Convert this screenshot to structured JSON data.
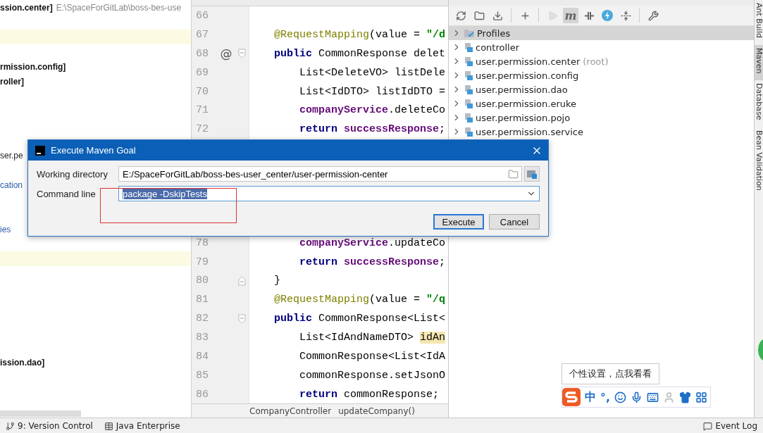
{
  "left_panel": {
    "rows": [
      {
        "kind": "header",
        "module": "ssion.center]",
        "path": "E:\\SpaceForGitLab\\boss-bes-use"
      },
      {
        "kind": "band"
      },
      {
        "kind": "module",
        "text": "rmission.config]"
      },
      {
        "kind": "module",
        "text": "roller]"
      },
      {
        "kind": "plain",
        "text": "ser.pe"
      },
      {
        "kind": "link",
        "text": "cation"
      },
      {
        "kind": "link",
        "text": "ies"
      },
      {
        "kind": "band"
      },
      {
        "kind": "module",
        "text": "ission.dao]"
      }
    ]
  },
  "editor": {
    "blocks": [
      {
        "lines": [
          {
            "number": "66",
            "fold": false
          },
          {
            "number": "67",
            "fold": false,
            "tokens": [
              {
                "kind": "ann",
                "text": "@RequestMapping"
              },
              {
                "kind": "plain",
                "text": "(value = "
              },
              {
                "kind": "str",
                "text": "\"/d"
              }
            ]
          },
          {
            "number": "68",
            "marker": "@",
            "fold": true,
            "tokens": [
              {
                "kind": "kw",
                "text": "public"
              },
              {
                "kind": "plain",
                "text": " CommonResponse delet"
              }
            ],
            "children": [
              {
                "number": "69",
                "fold": false,
                "tokens": [
                  {
                    "kind": "plain",
                    "text": "List<DeleteVO> listDele"
                  }
                ]
              },
              {
                "number": "70",
                "fold": false,
                "tokens": [
                  {
                    "kind": "plain",
                    "text": "List<IdDTO> listIdDTO ="
                  }
                ]
              },
              {
                "number": "71",
                "fold": false,
                "tokens": [
                  {
                    "kind": "field",
                    "text": "companyService"
                  },
                  {
                    "kind": "plain",
                    "text": ".deleteCo"
                  }
                ]
              },
              {
                "number": "72",
                "fold": false,
                "tokens": [
                  {
                    "kind": "kw",
                    "text": "return"
                  },
                  {
                    "kind": "field",
                    "text": " successResponse"
                  },
                  {
                    "kind": "plain",
                    "text": ";"
                  }
                ]
              }
            ]
          }
        ]
      },
      {
        "continued": [
          {
            "number": "78",
            "fold": false,
            "tokens": [
              {
                "kind": "field",
                "text": "companyService"
              },
              {
                "kind": "plain",
                "text": ".updateCo"
              }
            ]
          },
          {
            "number": "79",
            "fold": false,
            "tokens": [
              {
                "kind": "kw",
                "text": "return"
              },
              {
                "kind": "field",
                "text": " successResponse"
              },
              {
                "kind": "plain",
                "text": ";"
              }
            ]
          }
        ],
        "lines": [
          {
            "number": "80",
            "fold": true,
            "tokens": [
              {
                "kind": "plain",
                "text": "}"
              }
            ]
          },
          {
            "number": "81",
            "fold": false,
            "tokens": [
              {
                "kind": "ann",
                "text": "@RequestMapping"
              },
              {
                "kind": "plain",
                "text": "(value = "
              },
              {
                "kind": "str",
                "text": "\"/q"
              }
            ]
          },
          {
            "number": "82",
            "fold": true,
            "tokens": [
              {
                "kind": "kw",
                "text": "public"
              },
              {
                "kind": "plain",
                "text": " CommonResponse<List<"
              }
            ],
            "children": [
              {
                "number": "83",
                "fold": false,
                "tokens": [
                  {
                    "kind": "plain",
                    "text": "List<IdAndNameDTO> "
                  },
                  {
                    "kind": "hl",
                    "text": "idAn"
                  }
                ]
              },
              {
                "number": "84",
                "fold": false,
                "tokens": [
                  {
                    "kind": "plain",
                    "text": "CommonResponse<List<IdA"
                  }
                ]
              },
              {
                "number": "85",
                "fold": false,
                "tokens": [
                  {
                    "kind": "plain",
                    "text": "commonResponse.setJsonO"
                  }
                ]
              },
              {
                "number": "86",
                "fold": false,
                "tokens": [
                  {
                    "kind": "kw",
                    "text": "return"
                  },
                  {
                    "kind": "plain",
                    "text": " commonResponse;"
                  }
                ]
              }
            ]
          }
        ]
      }
    ],
    "breadcrumb": [
      "CompanyController",
      "updateCompany()"
    ]
  },
  "maven": {
    "toolbar": [
      {
        "kind": "refresh",
        "selected": false,
        "disabled": false
      },
      {
        "kind": "folder",
        "selected": false,
        "disabled": false
      },
      {
        "kind": "download",
        "selected": false,
        "disabled": false
      },
      {
        "kind": "separator"
      },
      {
        "kind": "add",
        "selected": false,
        "disabled": false
      },
      {
        "kind": "separator"
      },
      {
        "kind": "run",
        "selected": false,
        "disabled": true
      },
      {
        "kind": "goal",
        "label": "m",
        "selected": true,
        "disabled": false
      },
      {
        "kind": "offline",
        "selected": false,
        "disabled": false
      },
      {
        "kind": "lightning",
        "selected": false,
        "disabled": false
      },
      {
        "kind": "collapse",
        "selected": false,
        "disabled": false
      },
      {
        "kind": "separator"
      },
      {
        "kind": "settings",
        "selected": false,
        "disabled": false
      }
    ],
    "tree": [
      {
        "kind": "profiles",
        "label": "Profiles",
        "selected": true
      },
      {
        "kind": "module",
        "label": "controller",
        "selected": false
      },
      {
        "kind": "module",
        "label": "user.permission.center",
        "note": "(root)",
        "selected": false
      },
      {
        "kind": "module",
        "label": "user.permission.config",
        "selected": false
      },
      {
        "kind": "module",
        "label": "user.permission.dao",
        "selected": false
      },
      {
        "kind": "module",
        "label": "user.permission.eruke",
        "selected": false
      },
      {
        "kind": "module",
        "label": "user.permission.pojo",
        "selected": false
      },
      {
        "kind": "module",
        "label": "user.permission.service",
        "selected": false
      }
    ]
  },
  "side_tabs": [
    {
      "label": "Ant Build",
      "selected": false
    },
    {
      "label": "Maven",
      "selected": true
    },
    {
      "label": "Database",
      "selected": false
    },
    {
      "label": "Bean Validation",
      "selected": false
    }
  ],
  "status_bar": [
    {
      "kind": "vcs",
      "label": "9: Version Control"
    },
    {
      "kind": "enterprise",
      "label": "Java Enterprise"
    },
    {
      "kind": "log",
      "label": "Event Log"
    }
  ],
  "dialog": {
    "title": "Execute Maven Goal",
    "working_directory": {
      "label": "Working directory",
      "value": "E:/SpaceForGitLab/boss-bes-user_center/user-permission-center"
    },
    "command_line": {
      "label": "Command line",
      "value": "package -DskipTests",
      "selected": true
    },
    "buttons": [
      {
        "label": "Execute",
        "default": true
      },
      {
        "label": "Cancel",
        "default": false
      }
    ]
  },
  "tooltip": {
    "text": "个性设置，点我看看"
  },
  "ime_toolbar": [
    {
      "kind": "logo"
    },
    {
      "kind": "text",
      "label": "中"
    },
    {
      "kind": "text",
      "label": "°,"
    },
    {
      "kind": "smiley"
    },
    {
      "kind": "mic"
    },
    {
      "kind": "keyboard"
    },
    {
      "kind": "person"
    },
    {
      "kind": "shirt"
    },
    {
      "kind": "grid"
    }
  ]
}
